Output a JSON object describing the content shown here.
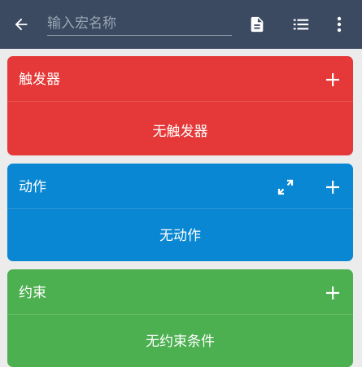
{
  "toolbar": {
    "name_input_placeholder": "输入宏名称",
    "name_input_value": "",
    "icons": [
      "back-arrow-icon",
      "document-icon",
      "list-icon",
      "more-vert-icon"
    ],
    "background_color": "#3b4a61"
  },
  "cards": {
    "trigger": {
      "title": "触发器",
      "empty_text": "无触发器",
      "color": "#e53838",
      "icons": [
        "plus-icon"
      ]
    },
    "action": {
      "title": "动作",
      "empty_text": "无动作",
      "color": "#0a87d2",
      "icons": [
        "expand-icon",
        "plus-icon"
      ]
    },
    "constraint": {
      "title": "约束",
      "empty_text": "无约束条件",
      "color": "#4caf50",
      "icons": [
        "plus-icon"
      ]
    }
  }
}
